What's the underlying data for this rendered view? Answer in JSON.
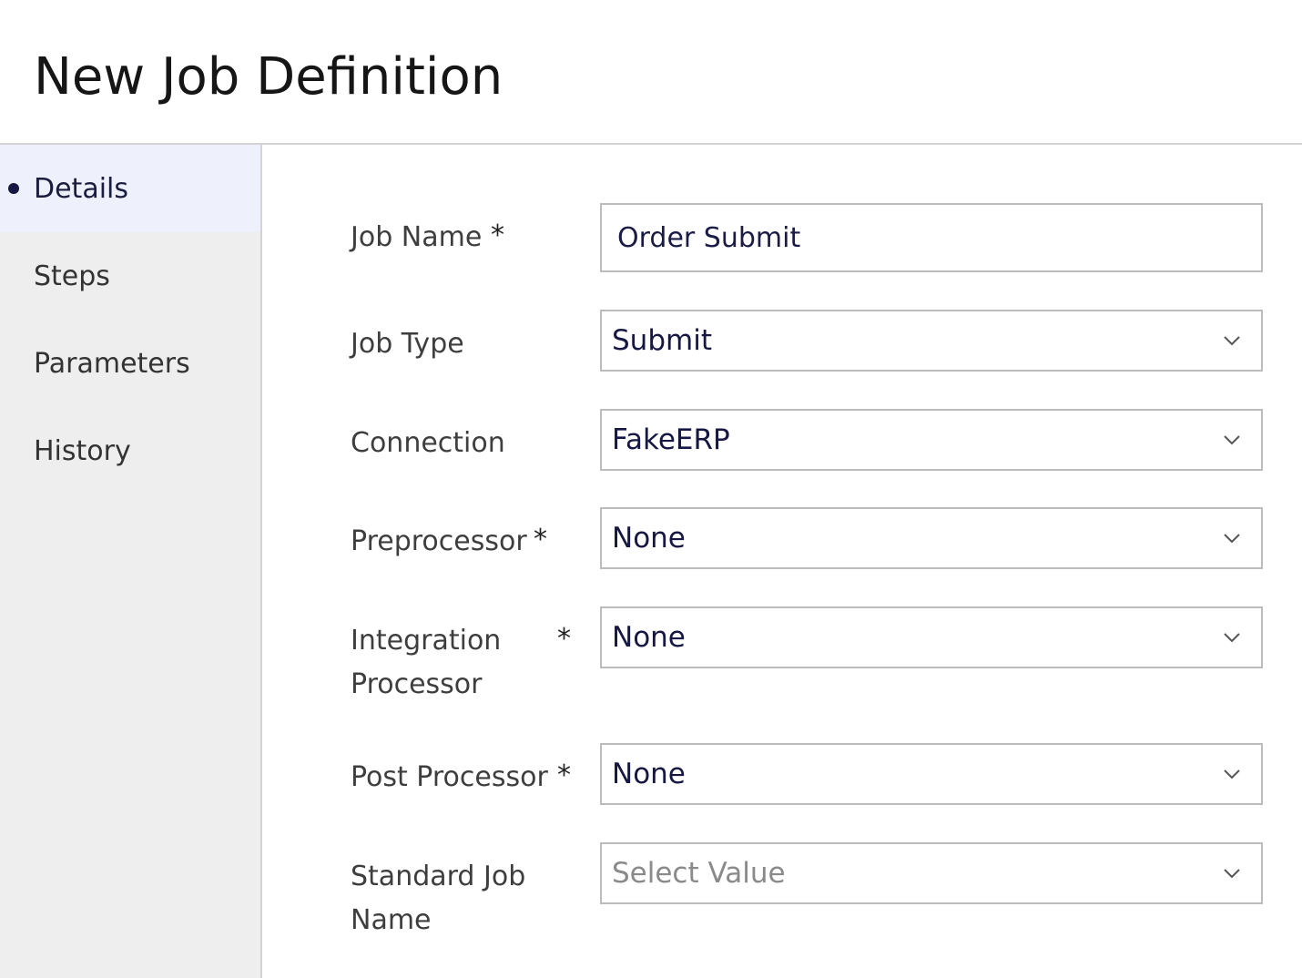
{
  "page": {
    "title": "New Job Definition"
  },
  "sidebar": {
    "items": [
      {
        "label": "Details",
        "active": true
      },
      {
        "label": "Steps",
        "active": false
      },
      {
        "label": "Parameters",
        "active": false
      },
      {
        "label": "History",
        "active": false
      }
    ]
  },
  "form": {
    "required_marker": "*",
    "job_name": {
      "label": "Job Name",
      "value": "Order Submit"
    },
    "job_type": {
      "label": "Job Type",
      "value": "Submit"
    },
    "connection": {
      "label": "Connection",
      "value": "FakeERP"
    },
    "preprocessor": {
      "label": "Preprocessor",
      "value": "None"
    },
    "integration_processor": {
      "label_line1": "Integration",
      "label_line2": "Processor",
      "value": "None"
    },
    "post_processor": {
      "label": "Post Processor",
      "value": "None"
    },
    "standard_job_name": {
      "label_line1": "Standard Job",
      "label_line2": "Name",
      "placeholder": "Select Value"
    }
  },
  "icons": {
    "dropdown": "chevron-down-icon",
    "active_indicator": "bullet-dot-icon"
  },
  "colors": {
    "accent_dark": "#161843",
    "active_nav_bg": "#eef0fc",
    "sidebar_bg": "#eeeeee",
    "border": "#bcbcbc"
  }
}
